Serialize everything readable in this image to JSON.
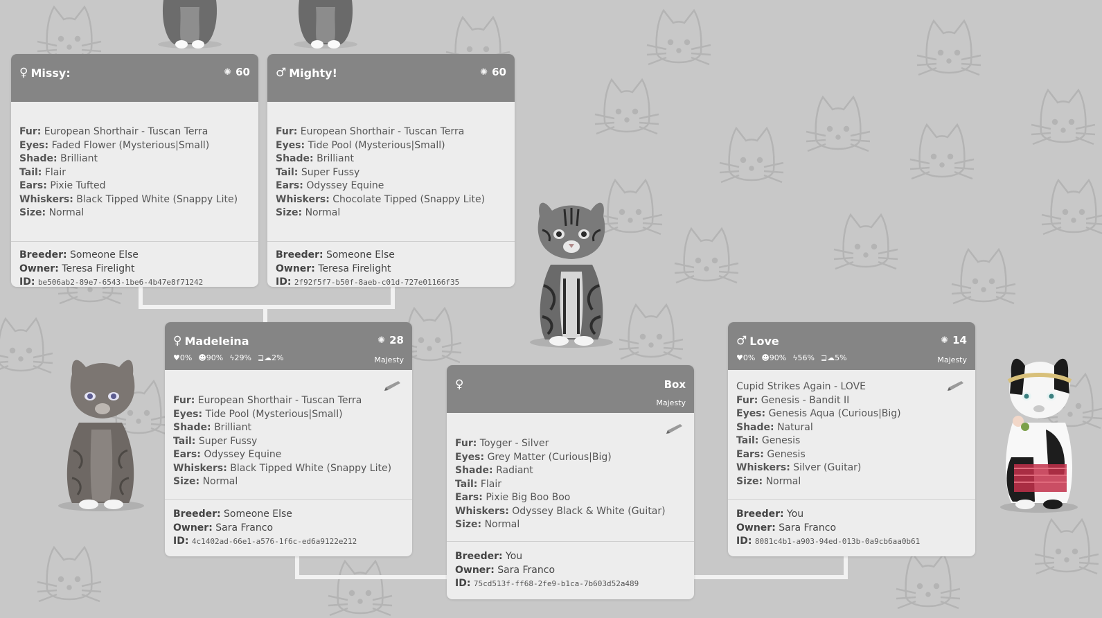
{
  "parents": {
    "missy": {
      "gender": "♀",
      "name": "Missy:",
      "gen_icon": "✺",
      "gen": "60",
      "fur_label": "Fur:",
      "fur": "European Shorthair - Tuscan Terra",
      "eyes_label": "Eyes:",
      "eyes": "Faded Flower (Mysterious|Small)",
      "shade_label": "Shade:",
      "shade": "Brilliant",
      "tail_label": "Tail:",
      "tail": "Flair",
      "ears_label": "Ears:",
      "ears": "Pixie Tufted",
      "whiskers_label": "Whiskers:",
      "whiskers": "Black Tipped White (Snappy Lite)",
      "size_label": "Size:",
      "size": "Normal",
      "breeder_label": "Breeder:",
      "breeder": "Someone Else",
      "owner_label": "Owner:",
      "owner": "Teresa Firelight",
      "id_label": "ID:",
      "id": "be506ab2-89e7-6543-1be6-4b47e8f71242"
    },
    "mighty": {
      "gender": "♂",
      "name": "Mighty!",
      "gen_icon": "✺",
      "gen": "60",
      "fur_label": "Fur:",
      "fur": "European Shorthair - Tuscan Terra",
      "eyes_label": "Eyes:",
      "eyes": "Tide Pool (Mysterious|Small)",
      "shade_label": "Shade:",
      "shade": "Brilliant",
      "tail_label": "Tail:",
      "tail": "Super Fussy",
      "ears_label": "Ears:",
      "ears": "Odyssey Equine",
      "whiskers_label": "Whiskers:",
      "whiskers": "Chocolate Tipped (Snappy Lite)",
      "size_label": "Size:",
      "size": "Normal",
      "breeder_label": "Breeder:",
      "breeder": "Someone Else",
      "owner_label": "Owner:",
      "owner": "Teresa Firelight",
      "id_label": "ID:",
      "id": "2f92f5f7-b50f-8aeb-c01d-727e01166f35"
    }
  },
  "madeleina": {
    "gender": "♀",
    "name": "Madeleina",
    "gen_icon": "✺",
    "gen": "28",
    "stat_love": "♥0%",
    "stat_happy": "☻90%",
    "stat_energy": "ϟ29%",
    "stat_rest": "⊒☁2%",
    "tag": "Majesty",
    "fur_label": "Fur:",
    "fur": "European Shorthair - Tuscan Terra",
    "eyes_label": "Eyes:",
    "eyes": "Tide Pool (Mysterious|Small)",
    "shade_label": "Shade:",
    "shade": "Brilliant",
    "tail_label": "Tail:",
    "tail": "Super Fussy",
    "ears_label": "Ears:",
    "ears": "Odyssey Equine",
    "whiskers_label": "Whiskers:",
    "whiskers": "Black Tipped White (Snappy Lite)",
    "size_label": "Size:",
    "size": "Normal",
    "breeder_label": "Breeder:",
    "breeder": "Someone Else",
    "owner_label": "Owner:",
    "owner": "Sara Franco",
    "id_label": "ID:",
    "id": "4c1402ad-66e1-a576-1f6c-ed6a9122e212"
  },
  "box": {
    "gender": "♀",
    "name": "Box",
    "tag": "Majesty",
    "fur_label": "Fur:",
    "fur": "Toyger - Silver",
    "eyes_label": "Eyes:",
    "eyes": "Grey Matter (Curious|Big)",
    "shade_label": "Shade:",
    "shade": "Radiant",
    "tail_label": "Tail:",
    "tail": "Flair",
    "ears_label": "Ears:",
    "ears": "Pixie Big Boo Boo",
    "whiskers_label": "Whiskers:",
    "whiskers": "Odyssey Black & White (Guitar)",
    "size_label": "Size:",
    "size": "Normal",
    "breeder_label": "Breeder:",
    "breeder": "You",
    "owner_label": "Owner:",
    "owner": "Sara Franco",
    "id_label": "ID:",
    "id": "75cd513f-ff68-2fe9-b1ca-7b603d52a489"
  },
  "love": {
    "gender": "♂",
    "name": "Love",
    "gen_icon": "✺",
    "gen": "14",
    "stat_love": "♥0%",
    "stat_happy": "☻90%",
    "stat_energy": "ϟ56%",
    "stat_rest": "⊒☁5%",
    "tag": "Majesty",
    "title": "Cupid Strikes Again - LOVE",
    "fur_label": "Fur:",
    "fur": "Genesis - Bandit II",
    "eyes_label": "Eyes:",
    "eyes": "Genesis Aqua (Curious|Big)",
    "shade_label": "Shade:",
    "shade": "Natural",
    "tail_label": "Tail:",
    "tail": "Genesis",
    "ears_label": "Ears:",
    "ears": "Genesis",
    "whiskers_label": "Whiskers:",
    "whiskers": "Silver (Guitar)",
    "size_label": "Size:",
    "size": "Normal",
    "breeder_label": "Breeder:",
    "breeder": "You",
    "owner_label": "Owner:",
    "owner": "Sara Franco",
    "id_label": "ID:",
    "id": "8081c4b1-a903-94ed-013b-0a9cb6aa0b61"
  },
  "icons": {
    "pencil": "pencil-icon",
    "generation": "generation-icon",
    "cat_silhouette": "cat-face-icon"
  },
  "colors": {
    "background": "#c8c8c8",
    "card": "#ededed",
    "card_header": "#858585",
    "connector": "#f2f2f2",
    "text": "#555555"
  }
}
